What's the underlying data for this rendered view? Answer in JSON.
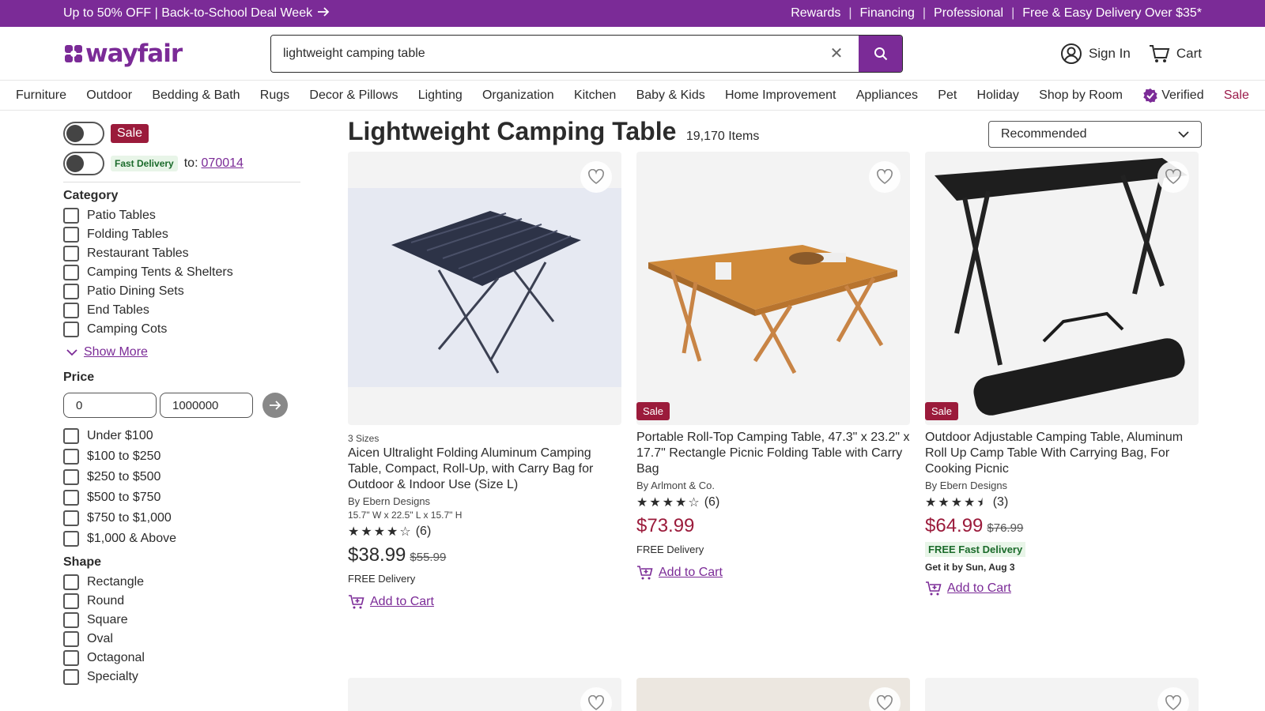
{
  "promo": {
    "left_text": "Up to 50% OFF | Back-to-School Deal Week",
    "links": [
      "Rewards",
      "Financing",
      "Professional",
      "Free & Easy Delivery Over $35*"
    ]
  },
  "header": {
    "logo_text": "wayfair",
    "search_value": "lightweight camping table",
    "sign_in": "Sign In",
    "cart": "Cart"
  },
  "nav": [
    "Furniture",
    "Outdoor",
    "Bedding & Bath",
    "Rugs",
    "Decor & Pillows",
    "Lighting",
    "Organization",
    "Kitchen",
    "Baby & Kids",
    "Home Improvement",
    "Appliances",
    "Pet",
    "Holiday",
    "Shop by Room"
  ],
  "nav_verified": "Verified",
  "nav_sale": "Sale",
  "sidebar": {
    "sale_label": "Sale",
    "fast_delivery_label": "Fast Delivery",
    "to_label": "to:",
    "zip": "070014",
    "category_title": "Category",
    "categories": [
      "Patio Tables",
      "Folding Tables",
      "Restaurant Tables",
      "Camping Tents & Shelters",
      "Patio Dining Sets",
      "End Tables",
      "Camping Cots"
    ],
    "show_more": "Show More",
    "price_title": "Price",
    "price_min": "0",
    "price_max": "1000000",
    "price_ranges": [
      "Under $100",
      "$100 to $250",
      "$250 to $500",
      "$500 to $750",
      "$750 to $1,000",
      "$1,000 & Above"
    ],
    "shape_title": "Shape",
    "shapes": [
      "Rectangle",
      "Round",
      "Square",
      "Oval",
      "Octagonal",
      "Specialty"
    ]
  },
  "results": {
    "title": "Lightweight Camping Table",
    "count": "19,170 Items",
    "sort": "Recommended"
  },
  "products": [
    {
      "sizes": "3 Sizes",
      "name": "Aicen Ultralight Folding Aluminum Camping Table, Compact, Roll-Up, with Carry Bag for Outdoor & Indoor Use (Size L)",
      "brand": "By Ebern Designs",
      "dims": "15.7\" W x 22.5\" L x 15.7\" H",
      "rating": 4,
      "reviews": "(6)",
      "price": "$38.99",
      "was": "$55.99",
      "delivery": "FREE Delivery",
      "add_to_cart": "Add to Cart",
      "sale_badge": ""
    },
    {
      "name": "Portable Roll-Top Camping Table, 47.3\" x 23.2\" x 17.7\" Rectangle Picnic Folding Table with Carry Bag",
      "brand": "By Arlmont & Co.",
      "rating": 4,
      "reviews": "(6)",
      "price": "$73.99",
      "delivery": "FREE Delivery",
      "add_to_cart": "Add to Cart",
      "sale_badge": "Sale"
    },
    {
      "name": "Outdoor Adjustable Camping Table, Aluminum Roll Up Camp Table With Carrying Bag, For Cooking Picnic",
      "brand": "By Ebern Designs",
      "rating": 4.5,
      "reviews": "(3)",
      "price": "$64.99",
      "was": "$76.99",
      "fast_delivery": "FREE Fast Delivery",
      "get_by": "Get it by Sun, Aug 3",
      "add_to_cart": "Add to Cart",
      "sale_badge": "Sale"
    }
  ],
  "colors": {
    "brand": "#7b2b97",
    "sale": "#9b1b3b",
    "fast": "#1b6b2b"
  }
}
